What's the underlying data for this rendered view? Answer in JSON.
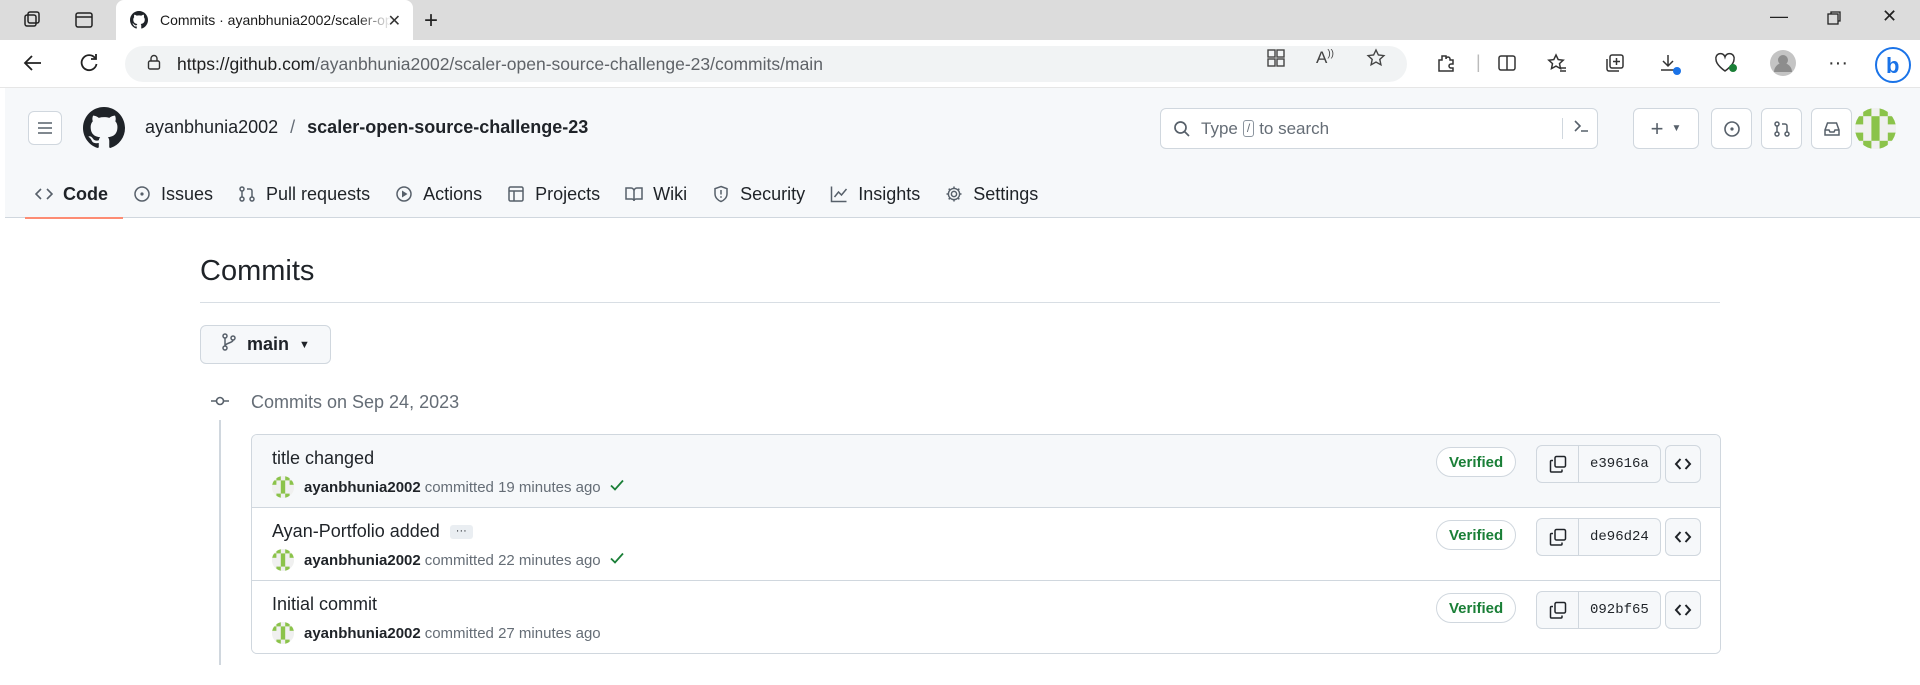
{
  "browser": {
    "tab_title": "Commits · ayanbhunia2002/scaler-open-source-challenge-23",
    "url_domain": "https://github.com",
    "url_path": "/ayanbhunia2002/scaler-open-source-challenge-23/commits/main"
  },
  "header": {
    "owner": "ayanbhunia2002",
    "separator": "/",
    "repo": "scaler-open-source-challenge-23",
    "search_prefix": "Type",
    "search_key": "/",
    "search_suffix": "to search"
  },
  "repo_nav": [
    {
      "label": "Code",
      "icon": "code-icon",
      "active": true
    },
    {
      "label": "Issues",
      "icon": "issue-icon"
    },
    {
      "label": "Pull requests",
      "icon": "pull-request-icon"
    },
    {
      "label": "Actions",
      "icon": "play-icon"
    },
    {
      "label": "Projects",
      "icon": "table-icon"
    },
    {
      "label": "Wiki",
      "icon": "book-icon"
    },
    {
      "label": "Security",
      "icon": "shield-icon"
    },
    {
      "label": "Insights",
      "icon": "graph-icon"
    },
    {
      "label": "Settings",
      "icon": "gear-icon"
    }
  ],
  "page": {
    "title": "Commits",
    "branch": "main",
    "group_date": "Commits on Sep 24, 2023"
  },
  "commits": [
    {
      "message": "title changed",
      "author": "ayanbhunia2002",
      "action": "committed",
      "time": "19 minutes ago",
      "verified": "Verified",
      "sha": "e39616a",
      "checks": true,
      "more": false
    },
    {
      "message": "Ayan-Portfolio added",
      "author": "ayanbhunia2002",
      "action": "committed",
      "time": "22 minutes ago",
      "verified": "Verified",
      "sha": "de96d24",
      "checks": true,
      "more": true,
      "more_label": "···"
    },
    {
      "message": "Initial commit",
      "author": "ayanbhunia2002",
      "action": "committed",
      "time": "27 minutes ago",
      "verified": "Verified",
      "sha": "092bf65",
      "checks": false,
      "more": false
    }
  ],
  "colors": {
    "accent_underline": "#fd8c73",
    "verified_green": "#1a7f37",
    "border": "#d0d7de"
  }
}
